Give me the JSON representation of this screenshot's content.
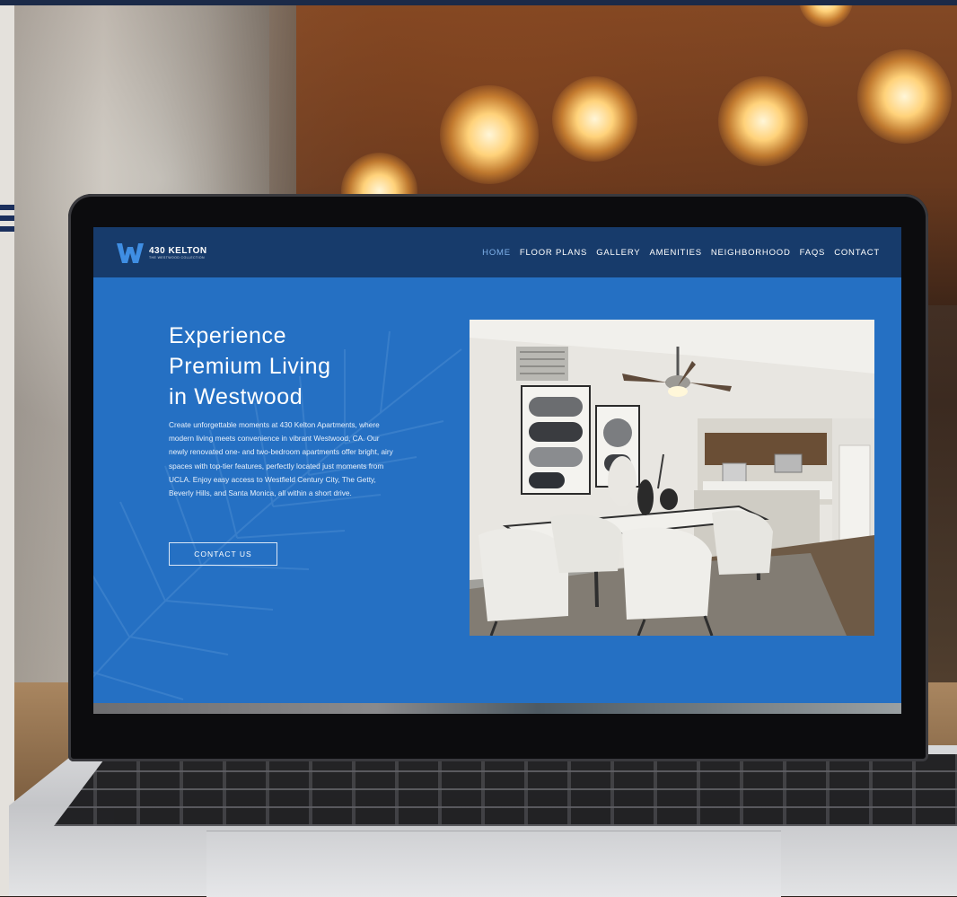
{
  "site": {
    "logo": {
      "name": "430 KELTON",
      "tagline": "THE WESTWOOD COLLECTION"
    },
    "nav": [
      {
        "label": "HOME",
        "active": true
      },
      {
        "label": "FLOOR PLANS",
        "active": false
      },
      {
        "label": "GALLERY",
        "active": false
      },
      {
        "label": "AMENITIES",
        "active": false
      },
      {
        "label": "NEIGHBORHOOD",
        "active": false
      },
      {
        "label": "FAQS",
        "active": false
      },
      {
        "label": "CONTACT",
        "active": false
      }
    ],
    "hero": {
      "title_line1": "Experience",
      "title_line2": "Premium Living",
      "title_line3": "in Westwood",
      "body": "Create unforgettable moments at 430 Kelton Apartments, where modern living meets convenience in vibrant Westwood, CA. Our newly renovated one- and two-bedroom apartments offer bright, airy spaces with top-tier features, perfectly located just moments from UCLA. Enjoy easy access to Westfield Century City, The Getty, Beverly Hills, and Santa Monica, all within a short drive.",
      "cta_label": "CONTACT US"
    }
  },
  "colors": {
    "nav_bg": "#173b6b",
    "hero_bg": "#2570c3",
    "active_link": "#7fb1ea",
    "logo_accent": "#3f8ee3"
  }
}
